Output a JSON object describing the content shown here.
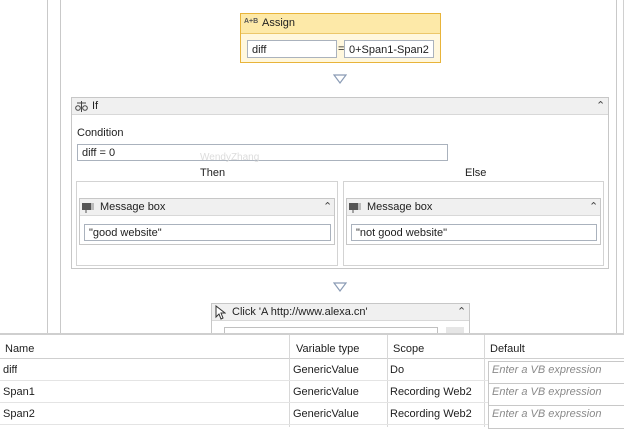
{
  "assign": {
    "title": "Assign",
    "icon_text": "A+B",
    "target": "diff",
    "operator": "=",
    "value": "0+Span1-Span2"
  },
  "if_activity": {
    "title": "If",
    "condition_label": "Condition",
    "condition_value": "diff = 0",
    "then_label": "Then",
    "else_label": "Else",
    "then_message": {
      "title": "Message box",
      "text": "\"good website\""
    },
    "else_message": {
      "title": "Message box",
      "text": "\"not good website\""
    }
  },
  "click_activity": {
    "title": "Click 'A  http://www.alexa.cn'"
  },
  "watermark": "WendyZhang",
  "variables": {
    "headers": [
      "Name",
      "Variable type",
      "Scope",
      "Default"
    ],
    "rows": [
      {
        "name": "diff",
        "type": "GenericValue",
        "scope": "Do",
        "default_placeholder": "Enter a VB expression"
      },
      {
        "name": "Span1",
        "type": "GenericValue",
        "scope": "Recording Web2",
        "default_placeholder": "Enter a VB expression"
      },
      {
        "name": "Span2",
        "type": "GenericValue",
        "scope": "Recording Web2",
        "default_placeholder": "Enter a VB expression"
      }
    ]
  },
  "colors": {
    "assign_border": "#e8b43a",
    "assign_header": "#fde9a8",
    "arrow": "#8a9bb5"
  }
}
